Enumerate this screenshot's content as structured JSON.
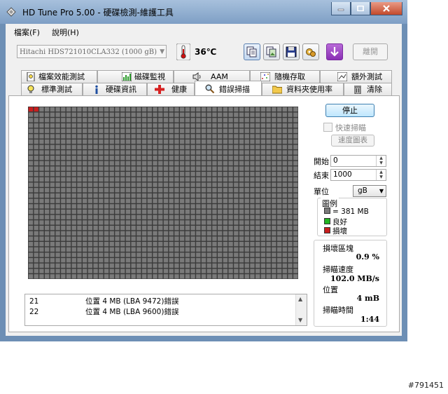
{
  "window": {
    "title": "HD Tune Pro  5.00 - 硬碟檢測-維護工具",
    "controls": [
      "minimize-icon",
      "maximize-icon",
      "close-icon"
    ]
  },
  "menu": [
    {
      "label": "檔案(F)"
    },
    {
      "label": "說明(H)"
    }
  ],
  "toolbar": {
    "drive": "Hitachi HDS721010CLA332 (1000 gB)",
    "temperature": "36℃",
    "icons": [
      "copy-text-icon",
      "copy-screenshot-icon",
      "save-icon",
      "options-icon",
      "download-icon"
    ],
    "exit_label": "離開"
  },
  "tabs_top": [
    {
      "label": "檔案效能測試",
      "icon": "file-benchmark-icon"
    },
    {
      "label": "磁碟監視",
      "icon": "disk-monitor-icon"
    },
    {
      "label": "AAM",
      "icon": "speaker-icon"
    },
    {
      "label": "隨機存取",
      "icon": "random-access-icon"
    },
    {
      "label": "額外測試",
      "icon": "extra-tests-icon"
    }
  ],
  "tabs_bottom": [
    {
      "label": "標準測試",
      "icon": "lightbulb-icon"
    },
    {
      "label": "硬碟資訊",
      "icon": "info-icon"
    },
    {
      "label": "健康",
      "icon": "health-cross-icon"
    },
    {
      "label": "錯誤掃描",
      "icon": "magnifier-icon",
      "active": true
    },
    {
      "label": "資料夾使用率",
      "icon": "folder-icon"
    },
    {
      "label": "清除",
      "icon": "trash-icon"
    }
  ],
  "scan": {
    "grid_cols": 50,
    "grid_rows": 32,
    "damaged_blocks": 2,
    "colors": {
      "cell": "#7a7a7a",
      "gridline": "#3a3a3a",
      "damaged": "#c81e1e",
      "ok": "#22b422"
    }
  },
  "log": [
    {
      "n": "21",
      "text": "位置 4 MB (LBA 9472)錯誤"
    },
    {
      "n": "22",
      "text": "位置 4 MB (LBA 9600)錯誤"
    }
  ],
  "controls": {
    "stop_label": "停止",
    "quick_scan_label": "快速掃瞄",
    "speed_map_label": "速度圖表",
    "start_label": "開始",
    "start_value": "0",
    "end_label": "結束",
    "end_value": "1000",
    "unit_label": "單位",
    "unit_value": "gB"
  },
  "legend": {
    "title": "圖例",
    "block": "= 381 MB",
    "good": "良好",
    "damaged": "損壞"
  },
  "stats": {
    "damaged_label": "損壞區塊",
    "damaged_value": "0.9 %",
    "speed_label": "掃瞄速度",
    "speed_value": "102.0 MB/s",
    "position_label": "位置",
    "position_value": "4 mB",
    "time_label": "掃瞄時間",
    "time_value": "1:44"
  },
  "watermark": "#791451"
}
